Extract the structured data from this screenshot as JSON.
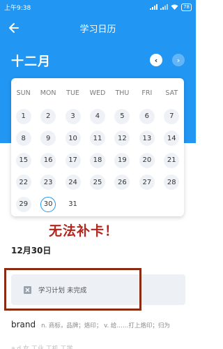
{
  "status_bar": {
    "time": "上午9:38",
    "battery": "78"
  },
  "app_bar": {
    "title": "学习日历"
  },
  "calendar": {
    "month": "十二月",
    "weekdays": [
      "SUN",
      "MON",
      "TUE",
      "WED",
      "THU",
      "FRI",
      "SAT"
    ],
    "days": [
      "1",
      "2",
      "3",
      "4",
      "5",
      "6",
      "7",
      "8",
      "9",
      "10",
      "11",
      "12",
      "13",
      "14",
      "15",
      "16",
      "17",
      "18",
      "19",
      "20",
      "21",
      "22",
      "23",
      "24",
      "25",
      "26",
      "27",
      "28",
      "29",
      "30",
      "31"
    ],
    "selected_day": "30"
  },
  "annotation": {
    "text": "无法补卡！"
  },
  "detail": {
    "date": "12月30日",
    "plan_status": "学习计划 未完成",
    "word": "brand",
    "meaning": "n. 商标，品牌；烙印；  v. 给……打上烙印；归为",
    "next_row_partial": "a d 女 工业 工机 工学"
  },
  "colors": {
    "primary": "#2196f3",
    "annotation": "#b3261e",
    "frame": "#8b2c12"
  }
}
